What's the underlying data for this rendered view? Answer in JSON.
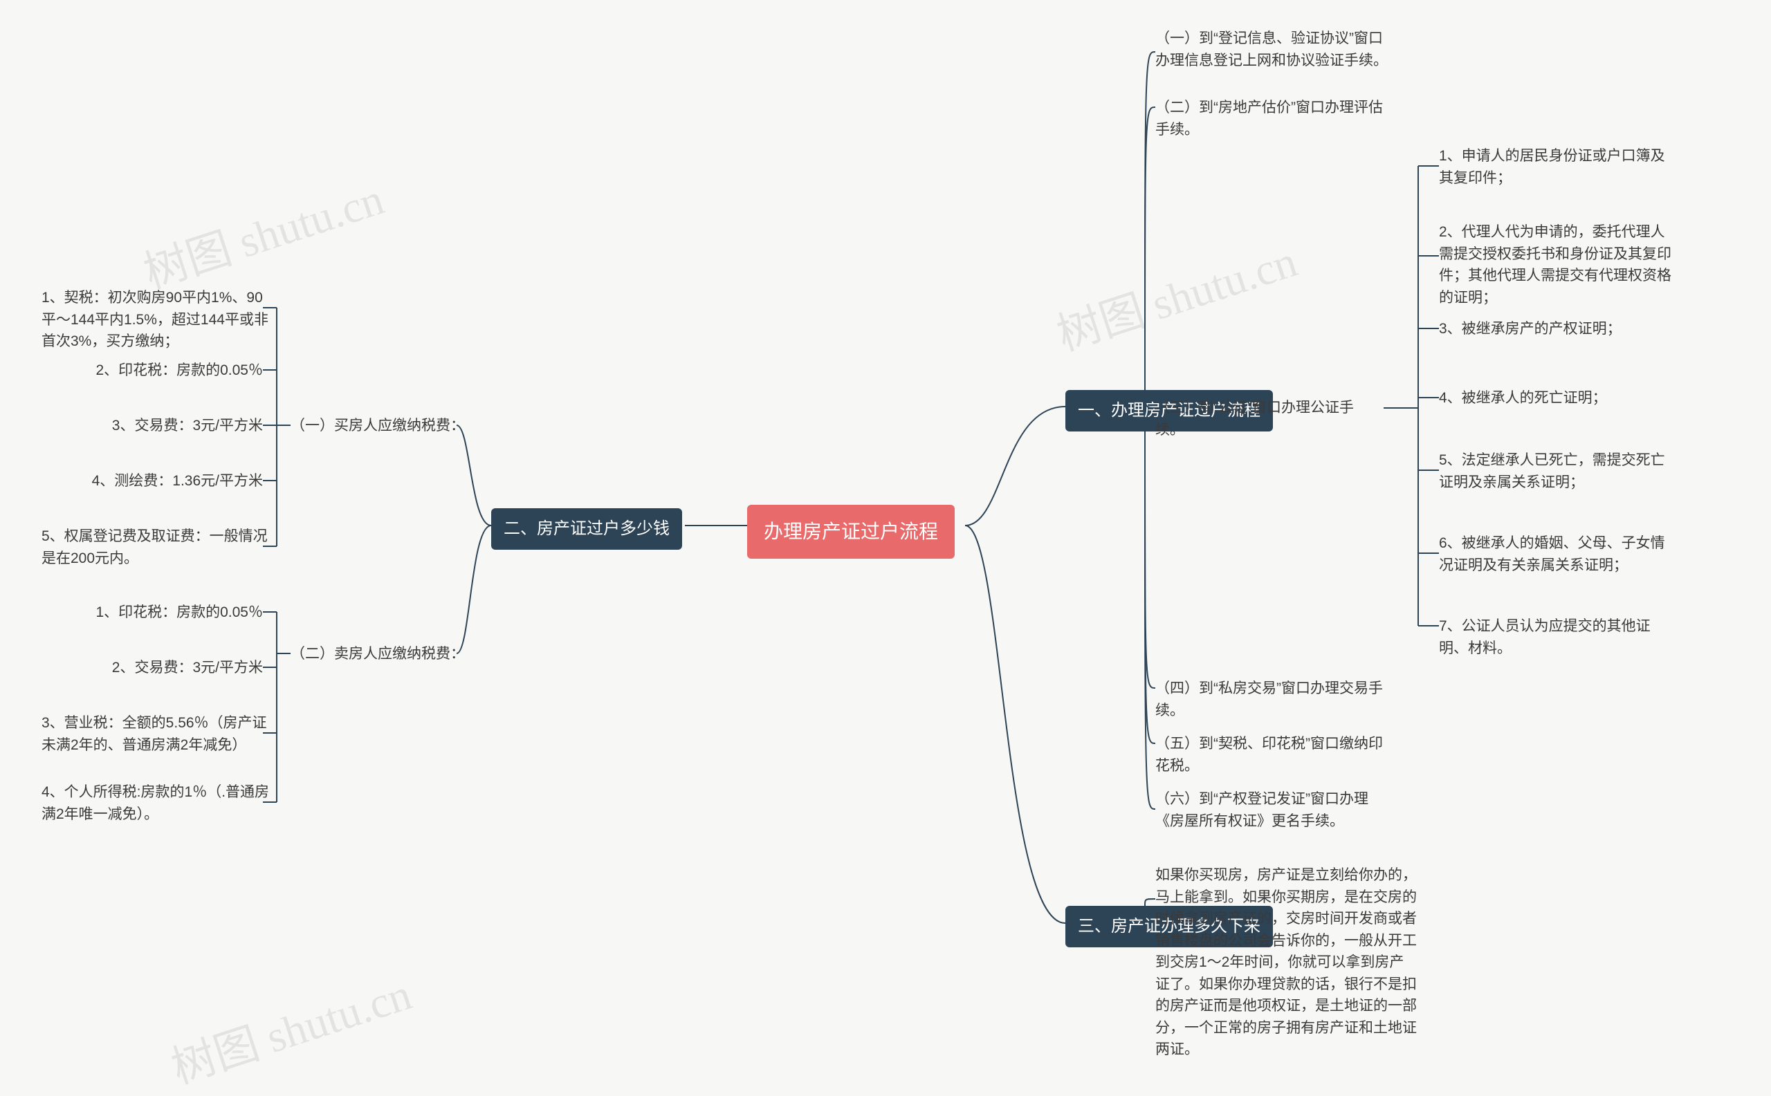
{
  "root": "办理房产证过户流程",
  "branch1": {
    "title": "一、办理房产证过户流程",
    "items": [
      "（一）到“登记信息、验证协议”窗口办理信息登记上网和协议验证手续。",
      "（二）到“房地产估价”窗口办理评估手续。",
      "（三）到“公证”窗口办理公证手续。",
      "（四）到“私房交易”窗口办理交易手续。",
      "（五）到“契税、印花税”窗口缴纳印花税。",
      "（六）到“产权登记发证”窗口办理《房屋所有权证》更名手续。"
    ],
    "sub3": [
      "1、申请人的居民身份证或户口簿及其复印件；",
      "2、代理人代为申请的，委托代理人需提交授权委托书和身份证及其复印件；其他代理人需提交有代理权资格的证明；",
      "3、被继承房产的产权证明；",
      "4、被继承人的死亡证明；",
      "5、法定继承人已死亡，需提交死亡证明及亲属关系证明；",
      "6、被继承人的婚姻、父母、子女情况证明及有关亲属关系证明；",
      "7、公证人员认为应提交的其他证明、材料。"
    ]
  },
  "branch2": {
    "title": "二、房产证过户多少钱",
    "buyer": {
      "title": "（一）买房人应缴纳税费：",
      "items": [
        "1、契税：初次购房90平内1%、90平～144平内1.5%，超过144平或非首次3%，买方缴纳；",
        "2、印花税：房款的0.05％",
        "3、交易费：3元/平方米",
        "4、测绘费：1.36元/平方米",
        "5、权属登记费及取证费：一般情况是在200元内。"
      ]
    },
    "seller": {
      "title": "（二）卖房人应缴纳税费：",
      "items": [
        "1、印花税：房款的0.05％",
        "2、交易费：3元/平方米",
        "3、营业税：全额的5.56％（房产证未满2年的、普通房满2年减免）",
        "4、个人所得税:房款的1％（.普通房满2年唯一减免）。"
      ]
    }
  },
  "branch3": {
    "title": "三、房产证办理多久下来",
    "text": "如果你买现房，房产证是立刻给你办的，马上能拿到。如果你买期房，是在交房的时候拿到房产证的，交房时间开发商或者销售楼盘的公司会告诉你的，一般从开工到交房1～2年时间，你就可以拿到房产证了。如果你办理贷款的话，银行不是扣的房产证而是他项权证，是土地证的一部分，一个正常的房子拥有房产证和土地证两证。"
  },
  "watermark": "树图 shutu.cn"
}
